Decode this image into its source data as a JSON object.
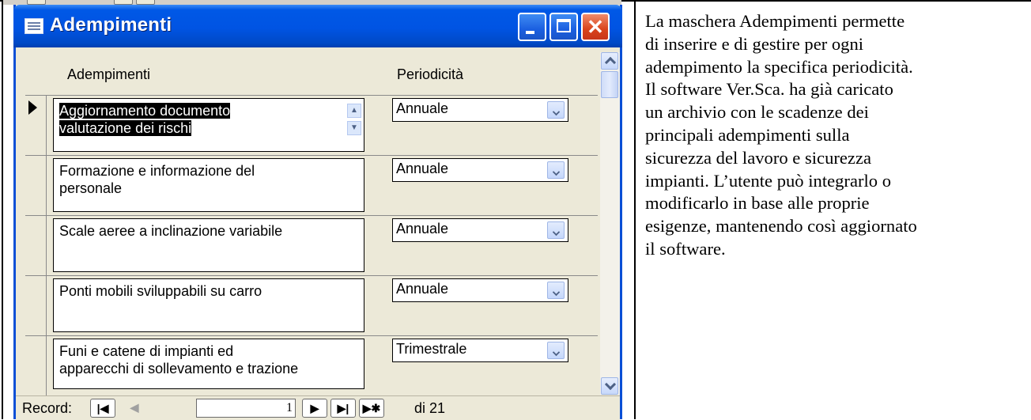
{
  "window": {
    "title": "Adempimenti",
    "colors": {
      "titlebar": "#0054e3",
      "close": "#d9441b",
      "face": "#ece9d8"
    }
  },
  "columns": {
    "adempimenti": "Adempimenti",
    "periodicita": "Periodicità"
  },
  "rows": [
    {
      "lines": [
        "Aggiornamento documento",
        "valutazione dei rischi"
      ],
      "periodicita": "Annuale",
      "current": true
    },
    {
      "lines": [
        "Formazione e informazione del",
        "personale"
      ],
      "periodicita": "Annuale",
      "current": false
    },
    {
      "lines": [
        "Scale aeree a inclinazione variabile",
        ""
      ],
      "periodicita": "Annuale",
      "current": false
    },
    {
      "lines": [
        "Ponti mobili sviluppabili su carro",
        ""
      ],
      "periodicita": "Annuale",
      "current": false
    },
    {
      "lines": [
        "Funi e catene di impianti ed",
        "apparecchi di sollevamento e trazione"
      ],
      "periodicita": "Trimestrale",
      "current": false
    }
  ],
  "navigation": {
    "label": "Record:",
    "current_record": "1",
    "of_label": "di 21",
    "icons": [
      "first-record-icon",
      "previous-record-icon",
      "next-record-icon",
      "last-record-icon",
      "new-record-icon"
    ]
  },
  "description": {
    "lines": [
      "La maschera Adempimenti permette",
      "di inserire e di gestire per ogni",
      "adempimento la specifica periodicità.",
      "Il software Ver.Sca. ha già caricato",
      "un archivio con le scadenze dei",
      "principali adempimenti sulla",
      "sicurezza del lavoro e sicurezza",
      "impianti. L’utente può integrarlo o",
      "modificarlo in base alle proprie",
      "esigenze, mantenendo così aggiornato",
      "il software."
    ]
  }
}
